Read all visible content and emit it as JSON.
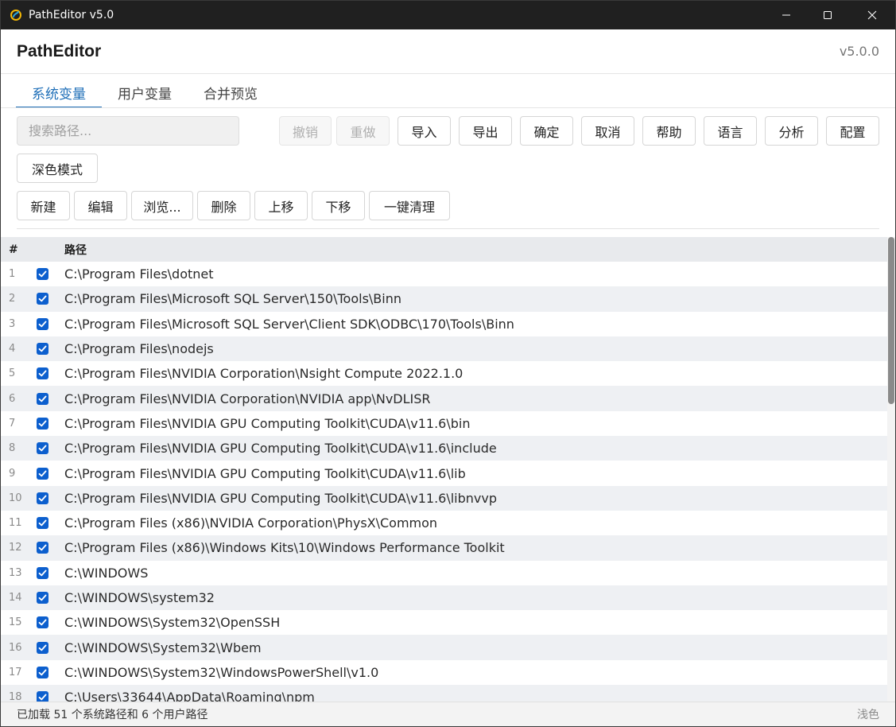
{
  "window": {
    "title": "PathEditor v5.0",
    "controls": {
      "minimize": "minimize-icon",
      "maximize": "maximize-icon",
      "close": "close-icon"
    }
  },
  "header": {
    "title": "PathEditor",
    "version": "v5.0.0"
  },
  "tabs": [
    {
      "label": "系统变量",
      "active": true
    },
    {
      "label": "用户变量",
      "active": false
    },
    {
      "label": "合并预览",
      "active": false
    }
  ],
  "search": {
    "placeholder": "搜索路径...",
    "value": ""
  },
  "toolbar": {
    "undo": "撤销",
    "redo": "重做",
    "import": "导入",
    "export": "导出",
    "confirm": "确定",
    "cancel": "取消",
    "help": "帮助",
    "language": "语言",
    "analyze": "分析",
    "config": "配置",
    "dark_mode": "深色模式"
  },
  "actions": {
    "new": "新建",
    "edit": "编辑",
    "browse": "浏览...",
    "delete": "删除",
    "move_up": "上移",
    "move_down": "下移",
    "clean": "一键清理"
  },
  "table": {
    "headers": {
      "num": "#",
      "path": "路径"
    },
    "rows": [
      {
        "num": "1",
        "checked": true,
        "path": "C:\\Program Files\\dotnet"
      },
      {
        "num": "2",
        "checked": true,
        "path": "C:\\Program Files\\Microsoft SQL Server\\150\\Tools\\Binn"
      },
      {
        "num": "3",
        "checked": true,
        "path": "C:\\Program Files\\Microsoft SQL Server\\Client SDK\\ODBC\\170\\Tools\\Binn"
      },
      {
        "num": "4",
        "checked": true,
        "path": "C:\\Program Files\\nodejs"
      },
      {
        "num": "5",
        "checked": true,
        "path": "C:\\Program Files\\NVIDIA Corporation\\Nsight Compute 2022.1.0"
      },
      {
        "num": "6",
        "checked": true,
        "path": "C:\\Program Files\\NVIDIA Corporation\\NVIDIA app\\NvDLISR"
      },
      {
        "num": "7",
        "checked": true,
        "path": "C:\\Program Files\\NVIDIA GPU Computing Toolkit\\CUDA\\v11.6\\bin"
      },
      {
        "num": "8",
        "checked": true,
        "path": "C:\\Program Files\\NVIDIA GPU Computing Toolkit\\CUDA\\v11.6\\include"
      },
      {
        "num": "9",
        "checked": true,
        "path": "C:\\Program Files\\NVIDIA GPU Computing Toolkit\\CUDA\\v11.6\\lib"
      },
      {
        "num": "10",
        "checked": true,
        "path": "C:\\Program Files\\NVIDIA GPU Computing Toolkit\\CUDA\\v11.6\\libnvvp"
      },
      {
        "num": "11",
        "checked": true,
        "path": "C:\\Program Files (x86)\\NVIDIA Corporation\\PhysX\\Common"
      },
      {
        "num": "12",
        "checked": true,
        "path": "C:\\Program Files (x86)\\Windows Kits\\10\\Windows Performance Toolkit"
      },
      {
        "num": "13",
        "checked": true,
        "path": "C:\\WINDOWS"
      },
      {
        "num": "14",
        "checked": true,
        "path": "C:\\WINDOWS\\system32"
      },
      {
        "num": "15",
        "checked": true,
        "path": "C:\\WINDOWS\\System32\\OpenSSH"
      },
      {
        "num": "16",
        "checked": true,
        "path": "C:\\WINDOWS\\System32\\Wbem"
      },
      {
        "num": "17",
        "checked": true,
        "path": "C:\\WINDOWS\\System32\\WindowsPowerShell\\v1.0"
      },
      {
        "num": "18",
        "checked": true,
        "path": "C:\\Users\\33644\\AppData\\Roaming\\npm"
      }
    ]
  },
  "status": {
    "text": "已加载 51 个系统路径和 6 个用户路径",
    "theme": "浅色"
  },
  "colors": {
    "accent": "#1f6fb8",
    "checkbox": "#0c5fce",
    "titlebar": "#202020"
  }
}
